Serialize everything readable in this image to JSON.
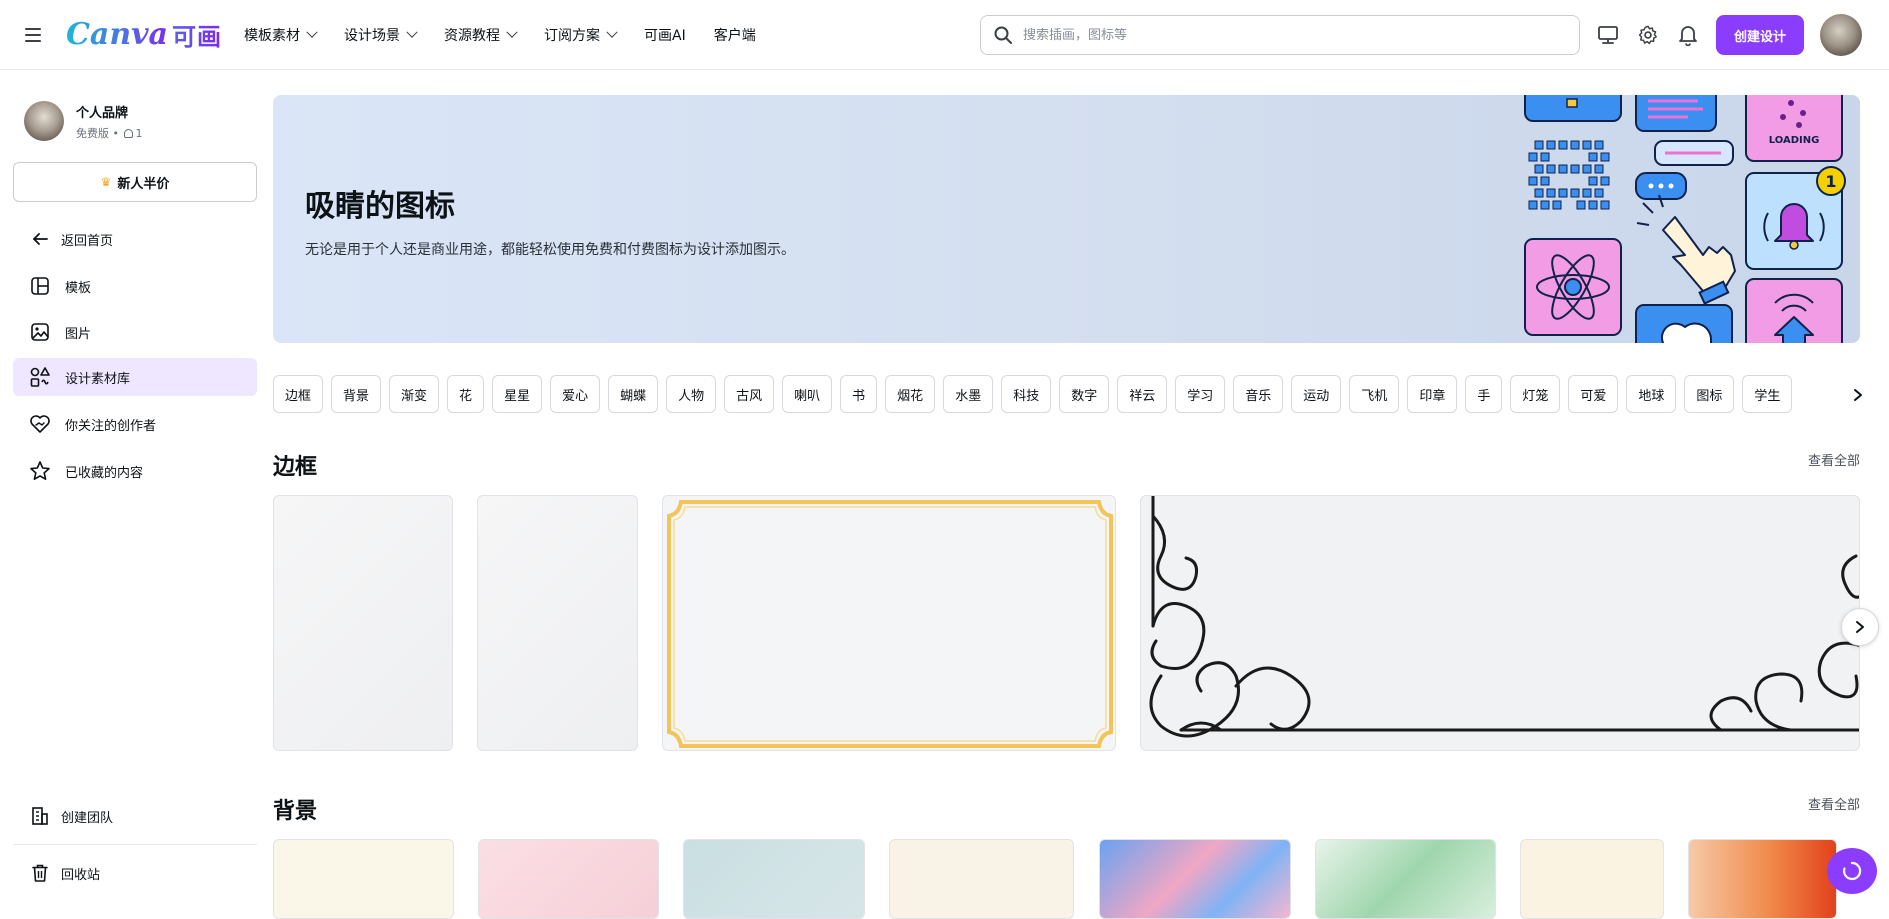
{
  "header": {
    "logo_word": "Canva",
    "logo_cn": "可画",
    "nav": [
      {
        "label": "模板素材",
        "has_dropdown": true
      },
      {
        "label": "设计场景",
        "has_dropdown": true
      },
      {
        "label": "资源教程",
        "has_dropdown": true
      },
      {
        "label": "订阅方案",
        "has_dropdown": true
      },
      {
        "label": "可画AI",
        "has_dropdown": false
      },
      {
        "label": "客户端",
        "has_dropdown": false
      }
    ],
    "search_placeholder": "搜索插画，图标等",
    "create_label": "创建设计",
    "accent_color": "#8b3dff"
  },
  "sidebar": {
    "profile_name": "个人品牌",
    "profile_plan": "免费版 • ",
    "profile_members": "1",
    "promo_label": "新人半价",
    "items": [
      {
        "label": "返回首页",
        "icon": "arrow-left-icon"
      },
      {
        "label": "模板",
        "icon": "template-icon"
      },
      {
        "label": "图片",
        "icon": "image-icon"
      },
      {
        "label": "设计素材库",
        "icon": "elements-icon",
        "active": true
      },
      {
        "label": "你关注的创作者",
        "icon": "heart-hands-icon"
      },
      {
        "label": "已收藏的内容",
        "icon": "star-icon"
      }
    ],
    "bottom_items": [
      {
        "label": "创建团队",
        "icon": "building-icon"
      },
      {
        "label": "回收站",
        "icon": "trash-icon"
      }
    ]
  },
  "hero": {
    "title": "吸睛的图标",
    "description": "无论是用于个人还是商业用途，都能轻松使用免费和付费图标为设计添加图示。",
    "art_loading_text": "LOADING",
    "art_badge": "1"
  },
  "chips": [
    "边框",
    "背景",
    "渐变",
    "花",
    "星星",
    "爱心",
    "蝴蝶",
    "人物",
    "古风",
    "喇叭",
    "书",
    "烟花",
    "水墨",
    "科技",
    "数字",
    "祥云",
    "学习",
    "音乐",
    "运动",
    "飞机",
    "印章",
    "手",
    "灯笼",
    "可爱",
    "地球",
    "图标",
    "学生"
  ],
  "sections": [
    {
      "title": "边框",
      "see_all": "查看全部"
    },
    {
      "title": "背景",
      "see_all": "查看全部"
    }
  ]
}
